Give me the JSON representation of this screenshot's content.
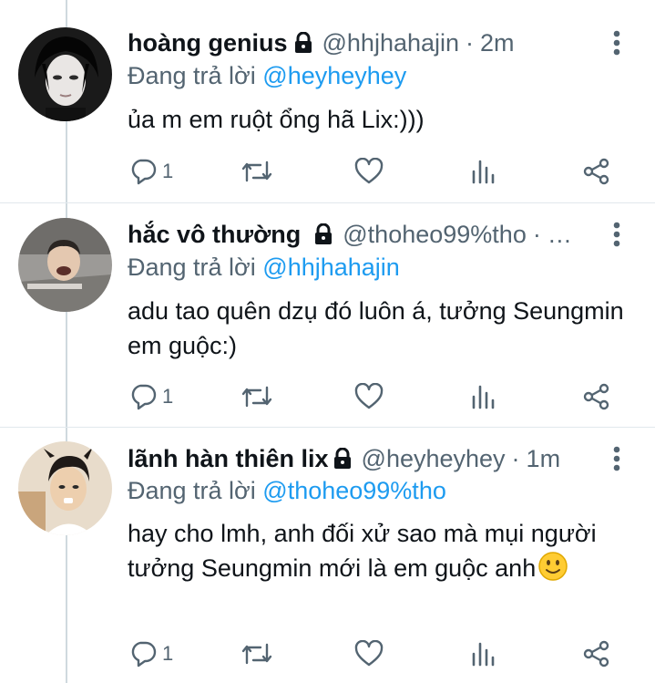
{
  "tweets": [
    {
      "name": "hoàng genius",
      "handle": "@hhjhahajin",
      "separator": "·",
      "time": "2m",
      "reply_prefix": "Đang trả lời",
      "reply_to": "@heyheyhey",
      "body": "ủa m em ruột ổng hã Lix:)))",
      "reply_count": "1",
      "avatar_color": "#222222"
    },
    {
      "name": "hắc vô thường",
      "handle": "@thoheo99%tho",
      "separator": "·",
      "time": "…",
      "reply_prefix": "Đang trả lời",
      "reply_to": "@hhjhahajin",
      "body": "adu tao quên dzụ đó luôn á, tưởng Seungmin em guộc:)",
      "reply_count": "1",
      "avatar_color": "#8c8c8c"
    },
    {
      "name": "lãnh hàn thiên lix",
      "handle": "@heyheyhey",
      "separator": "·",
      "time": "1m",
      "reply_prefix": "Đang trả lời",
      "reply_to": "@thoheo99%tho",
      "body": "hay cho lmh, anh đối xử sao mà mụi người tưởng Seungmin mới là em guộc anh",
      "reply_count": "1",
      "avatar_color": "#d9b48f"
    }
  ],
  "icons": {
    "lock": "lock-icon",
    "more": "more-vertical-icon",
    "reply": "reply-icon",
    "retweet": "retweet-icon",
    "like": "heart-icon",
    "analytics": "analytics-icon",
    "share": "share-icon",
    "emoji": "slightly-smiling-face-emoji"
  },
  "colors": {
    "text": "#0f1419",
    "secondary": "#536471",
    "mention": "#1d9bf0",
    "thread_line": "#cfd9de"
  }
}
